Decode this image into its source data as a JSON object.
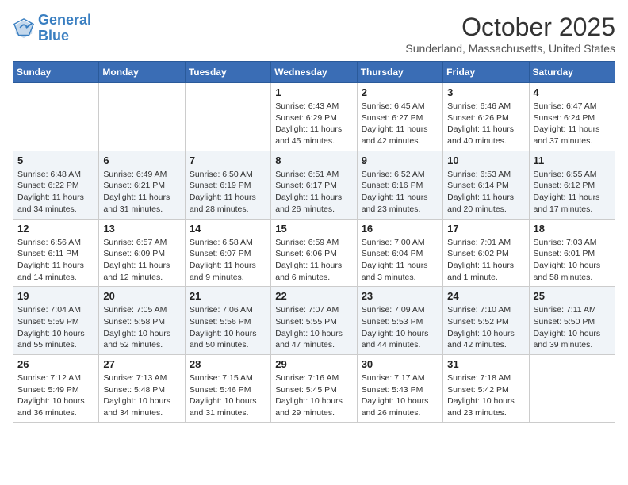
{
  "header": {
    "logo_line1": "General",
    "logo_line2": "Blue",
    "month": "October 2025",
    "location": "Sunderland, Massachusetts, United States"
  },
  "weekdays": [
    "Sunday",
    "Monday",
    "Tuesday",
    "Wednesday",
    "Thursday",
    "Friday",
    "Saturday"
  ],
  "weeks": [
    [
      {
        "day": "",
        "info": ""
      },
      {
        "day": "",
        "info": ""
      },
      {
        "day": "",
        "info": ""
      },
      {
        "day": "1",
        "info": "Sunrise: 6:43 AM\nSunset: 6:29 PM\nDaylight: 11 hours\nand 45 minutes."
      },
      {
        "day": "2",
        "info": "Sunrise: 6:45 AM\nSunset: 6:27 PM\nDaylight: 11 hours\nand 42 minutes."
      },
      {
        "day": "3",
        "info": "Sunrise: 6:46 AM\nSunset: 6:26 PM\nDaylight: 11 hours\nand 40 minutes."
      },
      {
        "day": "4",
        "info": "Sunrise: 6:47 AM\nSunset: 6:24 PM\nDaylight: 11 hours\nand 37 minutes."
      }
    ],
    [
      {
        "day": "5",
        "info": "Sunrise: 6:48 AM\nSunset: 6:22 PM\nDaylight: 11 hours\nand 34 minutes."
      },
      {
        "day": "6",
        "info": "Sunrise: 6:49 AM\nSunset: 6:21 PM\nDaylight: 11 hours\nand 31 minutes."
      },
      {
        "day": "7",
        "info": "Sunrise: 6:50 AM\nSunset: 6:19 PM\nDaylight: 11 hours\nand 28 minutes."
      },
      {
        "day": "8",
        "info": "Sunrise: 6:51 AM\nSunset: 6:17 PM\nDaylight: 11 hours\nand 26 minutes."
      },
      {
        "day": "9",
        "info": "Sunrise: 6:52 AM\nSunset: 6:16 PM\nDaylight: 11 hours\nand 23 minutes."
      },
      {
        "day": "10",
        "info": "Sunrise: 6:53 AM\nSunset: 6:14 PM\nDaylight: 11 hours\nand 20 minutes."
      },
      {
        "day": "11",
        "info": "Sunrise: 6:55 AM\nSunset: 6:12 PM\nDaylight: 11 hours\nand 17 minutes."
      }
    ],
    [
      {
        "day": "12",
        "info": "Sunrise: 6:56 AM\nSunset: 6:11 PM\nDaylight: 11 hours\nand 14 minutes."
      },
      {
        "day": "13",
        "info": "Sunrise: 6:57 AM\nSunset: 6:09 PM\nDaylight: 11 hours\nand 12 minutes."
      },
      {
        "day": "14",
        "info": "Sunrise: 6:58 AM\nSunset: 6:07 PM\nDaylight: 11 hours\nand 9 minutes."
      },
      {
        "day": "15",
        "info": "Sunrise: 6:59 AM\nSunset: 6:06 PM\nDaylight: 11 hours\nand 6 minutes."
      },
      {
        "day": "16",
        "info": "Sunrise: 7:00 AM\nSunset: 6:04 PM\nDaylight: 11 hours\nand 3 minutes."
      },
      {
        "day": "17",
        "info": "Sunrise: 7:01 AM\nSunset: 6:02 PM\nDaylight: 11 hours\nand 1 minute."
      },
      {
        "day": "18",
        "info": "Sunrise: 7:03 AM\nSunset: 6:01 PM\nDaylight: 10 hours\nand 58 minutes."
      }
    ],
    [
      {
        "day": "19",
        "info": "Sunrise: 7:04 AM\nSunset: 5:59 PM\nDaylight: 10 hours\nand 55 minutes."
      },
      {
        "day": "20",
        "info": "Sunrise: 7:05 AM\nSunset: 5:58 PM\nDaylight: 10 hours\nand 52 minutes."
      },
      {
        "day": "21",
        "info": "Sunrise: 7:06 AM\nSunset: 5:56 PM\nDaylight: 10 hours\nand 50 minutes."
      },
      {
        "day": "22",
        "info": "Sunrise: 7:07 AM\nSunset: 5:55 PM\nDaylight: 10 hours\nand 47 minutes."
      },
      {
        "day": "23",
        "info": "Sunrise: 7:09 AM\nSunset: 5:53 PM\nDaylight: 10 hours\nand 44 minutes."
      },
      {
        "day": "24",
        "info": "Sunrise: 7:10 AM\nSunset: 5:52 PM\nDaylight: 10 hours\nand 42 minutes."
      },
      {
        "day": "25",
        "info": "Sunrise: 7:11 AM\nSunset: 5:50 PM\nDaylight: 10 hours\nand 39 minutes."
      }
    ],
    [
      {
        "day": "26",
        "info": "Sunrise: 7:12 AM\nSunset: 5:49 PM\nDaylight: 10 hours\nand 36 minutes."
      },
      {
        "day": "27",
        "info": "Sunrise: 7:13 AM\nSunset: 5:48 PM\nDaylight: 10 hours\nand 34 minutes."
      },
      {
        "day": "28",
        "info": "Sunrise: 7:15 AM\nSunset: 5:46 PM\nDaylight: 10 hours\nand 31 minutes."
      },
      {
        "day": "29",
        "info": "Sunrise: 7:16 AM\nSunset: 5:45 PM\nDaylight: 10 hours\nand 29 minutes."
      },
      {
        "day": "30",
        "info": "Sunrise: 7:17 AM\nSunset: 5:43 PM\nDaylight: 10 hours\nand 26 minutes."
      },
      {
        "day": "31",
        "info": "Sunrise: 7:18 AM\nSunset: 5:42 PM\nDaylight: 10 hours\nand 23 minutes."
      },
      {
        "day": "",
        "info": ""
      }
    ]
  ]
}
